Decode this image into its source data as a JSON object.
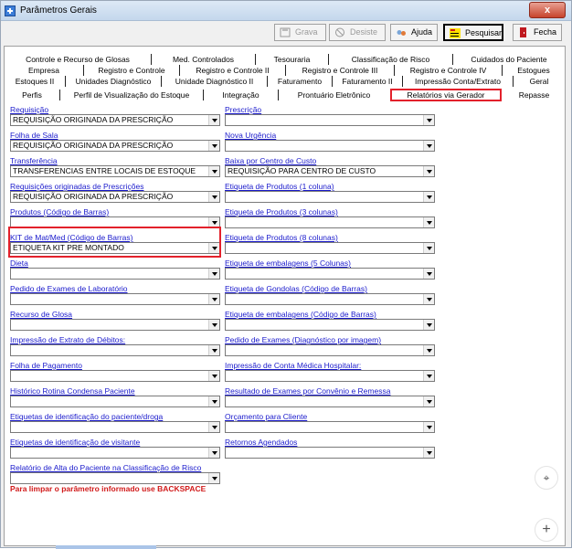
{
  "window": {
    "title": "Parâmetros Gerais",
    "close_glyph": "x"
  },
  "toolbar": {
    "grava": "Grava",
    "desiste": "Desiste",
    "ajuda": "Ajuda",
    "pesquisar": "Pesquisar",
    "fecha": "Fecha"
  },
  "tabs": {
    "row1": [
      "Controle e Recurso de Glosas",
      "Med. Controlados",
      "Tesouraria",
      "Classificação de Risco",
      "Cuidados do Paciente"
    ],
    "row2": [
      "Empresa",
      "Registro e Controle",
      "Registro e Controle II",
      "Registro e Controle III",
      "Registro e Controle IV",
      "Estogues"
    ],
    "row3": [
      "Estoques II",
      "Unidades Diagnóstico",
      "Unidade Diagnóstico II",
      "Faturamento",
      "Faturamento II",
      "Impressão Conta/Extrato",
      "Geral"
    ],
    "row4": [
      "Perfis",
      "Perfil de Visualização do Estoque",
      "Integração",
      "Prontuário Eletrônico",
      "Relatórios via Gerador",
      "Repasse"
    ]
  },
  "left_fields": [
    {
      "label": "Requisição",
      "value": "REQUISIÇÃO ORIGINADA DA PRESCRIÇÃO"
    },
    {
      "label": "Folha de Sala",
      "value": "REQUISIÇÃO ORIGINADA DA PRESCRIÇÃO"
    },
    {
      "label": "Transferência",
      "value": "TRANSFERENCIAS ENTRE LOCAIS DE ESTOQUE"
    },
    {
      "label": "Requisições originadas de Prescrições",
      "value": "REQUISIÇÃO ORIGINADA DA PRESCRIÇÃO"
    },
    {
      "label": "Produtos (Código de Barras)",
      "value": ""
    },
    {
      "label": "KIT de Mat/Med (Código de Barras)",
      "value": "ETIQUETA KIT PRE MONTADO"
    },
    {
      "label": "Dieta",
      "value": ""
    },
    {
      "label": "Pedido de Exames de Laboratório",
      "value": ""
    },
    {
      "label": "Recurso de Glosa",
      "value": ""
    },
    {
      "label": "Impressão de Extrato de Débitos:",
      "value": ""
    },
    {
      "label": "Folha de Pagamento",
      "value": ""
    },
    {
      "label": "Histórico Rotina Condensa Paciente",
      "value": ""
    },
    {
      "label": "Etiquetas de identificação do paciente/droga",
      "value": ""
    },
    {
      "label": "Etiquetas de identificação de visitante",
      "value": ""
    },
    {
      "label": "Relatório de Alta do Paciente na Classificação de Risco",
      "value": ""
    }
  ],
  "right_fields": [
    {
      "label": "Prescrição",
      "value": ""
    },
    {
      "label": "Nova Urgência",
      "value": ""
    },
    {
      "label": "Baixa por Centro de Custo",
      "value": "REQUISIÇÃO PARA CENTRO DE CUSTO"
    },
    {
      "label": "Etiqueta de Produtos (1 coluna)",
      "value": ""
    },
    {
      "label": "Etiqueta de Produtos (3 colunas)",
      "value": ""
    },
    {
      "label": "Etiqueta de Produtos (8 colunas)",
      "value": ""
    },
    {
      "label": "Etiqueta de embalagens (5 Colunas)",
      "value": ""
    },
    {
      "label": "Etiqueta de Gondolas (Código de Barras)",
      "value": ""
    },
    {
      "label": "Etiqueta de embalagens (Código de Barras)",
      "value": ""
    },
    {
      "label": "Pedido de Exames (Diagnóstico por imagem)",
      "value": ""
    },
    {
      "label": "Impressão de Conta Médica Hospitalar:",
      "value": ""
    },
    {
      "label": "Resultado de Exames por Convênio e Remessa",
      "value": ""
    },
    {
      "label": "Orçamento para Cliente",
      "value": ""
    },
    {
      "label": "Retornos Agendados",
      "value": ""
    }
  ],
  "hint": "Para limpar o parâmetro informado use BACKSPACE",
  "fabs": {
    "collapse": "⌖",
    "add": "+"
  },
  "colors": {
    "highlight": "#e3212b",
    "hint": "#d11a1a",
    "label": "#1a1acc"
  }
}
